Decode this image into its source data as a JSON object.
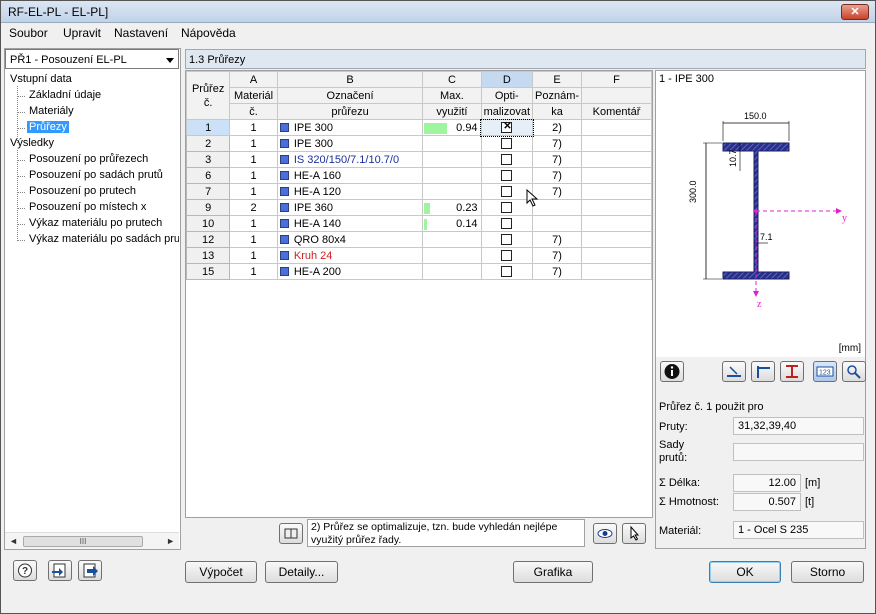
{
  "window": {
    "title": "RF-EL-PL - EL-PL]",
    "close_glyph": "✕"
  },
  "menu": [
    "Soubor",
    "Upravit",
    "Nastavení",
    "Nápověda"
  ],
  "case_dropdown": {
    "value": "PŘ1 - Posouzení EL-PL"
  },
  "tree": {
    "input_header": "Vstupní data",
    "input_items": [
      "Základní údaje",
      "Materiály",
      "Průřezy"
    ],
    "results_header": "Výsledky",
    "results_items": [
      "Posouzení po průřezech",
      "Posouzení po sadách prutů",
      "Posouzení po prutech",
      "Posouzení po místech x",
      "Výkaz materiálu po prutech",
      "Výkaz materiálu po sadách prut"
    ]
  },
  "scrollbar": {
    "left": "◄",
    "thumb": "III",
    "right": "►"
  },
  "section_title": "1.3 Průřezy",
  "grid": {
    "col_letters": [
      "A",
      "B",
      "C",
      "D",
      "E",
      "F"
    ],
    "headers": {
      "rownum": [
        "Průřez",
        "č."
      ],
      "material": [
        "Materiál",
        "č."
      ],
      "name": [
        "Označení",
        "průřezu"
      ],
      "util": [
        "Max.",
        "využití"
      ],
      "opt": [
        "Opti-",
        "malizovat"
      ],
      "note": [
        "Poznám-",
        "ka"
      ],
      "comment": [
        "",
        "Komentář"
      ]
    },
    "rows": [
      {
        "no": "1",
        "mat": "1",
        "name": "IPE 300",
        "style": "",
        "util": 0.94,
        "util_text": "0.94",
        "opt": true,
        "note": "2)"
      },
      {
        "no": "2",
        "mat": "1",
        "name": "IPE 300",
        "style": "",
        "util": null,
        "util_text": "",
        "opt": false,
        "note": "7)"
      },
      {
        "no": "3",
        "mat": "1",
        "name": "IS 320/150/7.1/10.7/0",
        "style": "blue",
        "util": null,
        "util_text": "",
        "opt": false,
        "note": "7)"
      },
      {
        "no": "6",
        "mat": "1",
        "name": "HE-A 160",
        "style": "",
        "util": null,
        "util_text": "",
        "opt": false,
        "note": "7)"
      },
      {
        "no": "7",
        "mat": "1",
        "name": "HE-A 120",
        "style": "",
        "util": null,
        "util_text": "",
        "opt": false,
        "note": "7)"
      },
      {
        "no": "9",
        "mat": "2",
        "name": "IPE 360",
        "style": "",
        "util": 0.23,
        "util_text": "0.23",
        "opt": false,
        "note": ""
      },
      {
        "no": "10",
        "mat": "1",
        "name": "HE-A 140",
        "style": "",
        "util": 0.14,
        "util_text": "0.14",
        "opt": false,
        "note": ""
      },
      {
        "no": "12",
        "mat": "1",
        "name": "QRO 80x4",
        "style": "",
        "util": null,
        "util_text": "",
        "opt": false,
        "note": "7)"
      },
      {
        "no": "13",
        "mat": "1",
        "name": "Kruh 24",
        "style": "red",
        "util": null,
        "util_text": "",
        "opt": false,
        "note": "7)"
      },
      {
        "no": "15",
        "mat": "1",
        "name": "HE-A 200",
        "style": "",
        "util": null,
        "util_text": "",
        "opt": false,
        "note": "7)"
      }
    ]
  },
  "footnote": "2) Průřez se optimalizuje, tzn. bude vyhledán nejlépe využitý průřez řady.",
  "drawing": {
    "label": "1 - IPE 300",
    "width_dim": "150.0",
    "height_dim": "300.0",
    "flange_dim": "10.7",
    "web_dim": "7.1",
    "y_axis": "y",
    "z_axis": "z",
    "units": "[mm]"
  },
  "props": {
    "used_for": "Průřez č. 1 použit pro",
    "members_label": "Pruty:",
    "members_value": "31,32,39,40",
    "sets_label": "Sady\nprutů:",
    "sets_value": "",
    "length_label": "Σ Délka:",
    "length_value": "12.00",
    "length_unit": "[m]",
    "mass_label": "Σ Hmotnost:",
    "mass_value": "0.507",
    "mass_unit": "[t]",
    "material_label": "Materiál:",
    "material_value": "1 - Ocel S 235"
  },
  "buttons": {
    "calc": "Výpočet",
    "details": "Detaily...",
    "graphics": "Grafika",
    "ok": "OK",
    "cancel": "Storno"
  },
  "colors": {
    "section_swatch": "#4c6ed8",
    "util_bar": "#9ef59e",
    "selection": "#3399ff"
  }
}
